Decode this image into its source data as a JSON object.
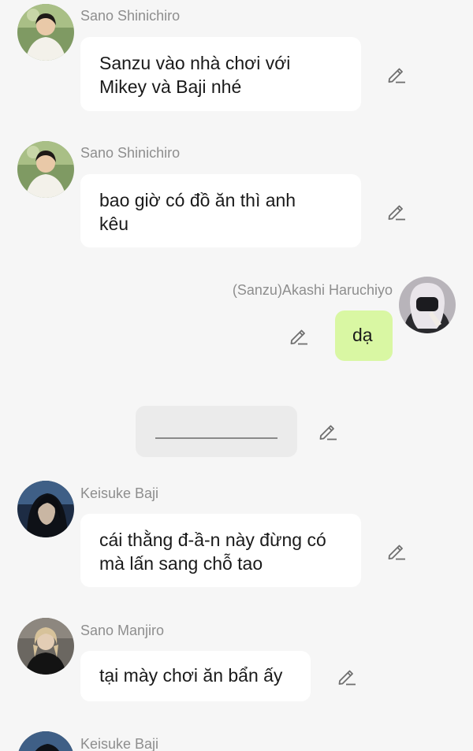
{
  "chat": {
    "messages": [
      {
        "sender": "Sano Shinichiro",
        "text": "Sanzu vào nhà chơi với\nMikey và Baji nhé"
      },
      {
        "sender": "Sano Shinichiro",
        "text": "bao giờ có đồ ăn thì anh\nkêu"
      },
      {
        "sender": "(Sanzu)Akashi Haruchiyo",
        "text": "dạ"
      },
      {
        "sender": "Keisuke Baji",
        "text": "cái thằng đ-ầ-n này đừng có\nmà lấn sang chỗ tao"
      },
      {
        "sender": "Sano Manjiro",
        "text": "tại mày chơi ăn bẩn ấy"
      },
      {
        "sender": "Keisuke Baji"
      }
    ]
  },
  "icons": {
    "edit": "pencil-edit-icon",
    "avatar": "user-avatar"
  },
  "colors": {
    "background": "#f6f6f6",
    "bubble_incoming": "#ffffff",
    "bubble_outgoing": "#d9f7a3",
    "bubble_placeholder": "#ebebeb",
    "sender_name": "#8e8e8e",
    "message_text": "#1a1a1a",
    "edit_icon": "#6f6f6f"
  }
}
